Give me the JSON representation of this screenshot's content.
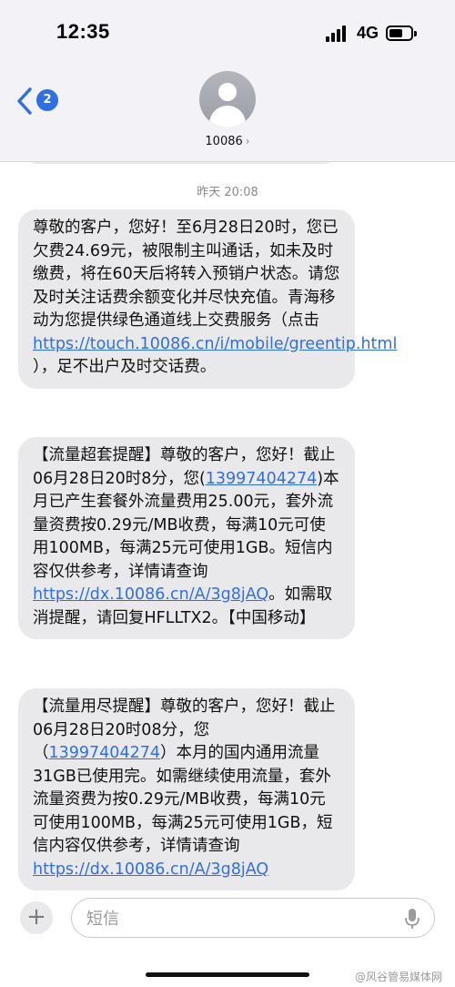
{
  "status_bar": {
    "time": "12:35",
    "network": "4G"
  },
  "nav": {
    "back_badge": "2",
    "contact_name": "10086",
    "contact_chevron": "›"
  },
  "thread": {
    "day_label": "昨天 20:08",
    "messages": [
      {
        "part1": "尊敬的客户，您好！至6月28日20时，您已欠费24.69元，被限制主叫通话，如未及时缴费，将在60天后将转入预销户状态。请您及时关注话费余额变化并尽快充值。青海移动为您提供绿色通道线上交费服务（点击 ",
        "link": "https://touch.10086.cn/i/mobile/greentip.html",
        "part2": " ），足不出户及时交话费。"
      },
      {
        "part1": "【流量超套提醒】尊敬的客户，您好！截止06月28日20时8分，您(",
        "number": "13997404274",
        "part2": ")本月已产生套餐外流量费用25.00元，套外流量资费按0.29元/MB收费，每满10元可使用100MB，每满25元可使用1GB。短信内容仅供参考，详情请查询 ",
        "link": "https://dx.10086.cn/A/3g8jAQ",
        "part3": "。如需取消提醒，请回复HFLLTX2。【中国移动】"
      },
      {
        "part1": "【流量用尽提醒】尊敬的客户，您好！截止06月28日20时08分，您（",
        "number": "13997404274",
        "part2": "）本月的国内通用流量31GB已使用完。如需继续使用流量，套外流量资费为按0.29元/MB收费，每满10元可使用100MB，每满25元可使用1GB，短信内容仅供参考，详情请查询 ",
        "link": "https://dx.10086.cn/A/3g8jAQ"
      }
    ]
  },
  "compose": {
    "plus_label": "+",
    "placeholder": "短信"
  },
  "watermark": "@风谷管易媒体网"
}
